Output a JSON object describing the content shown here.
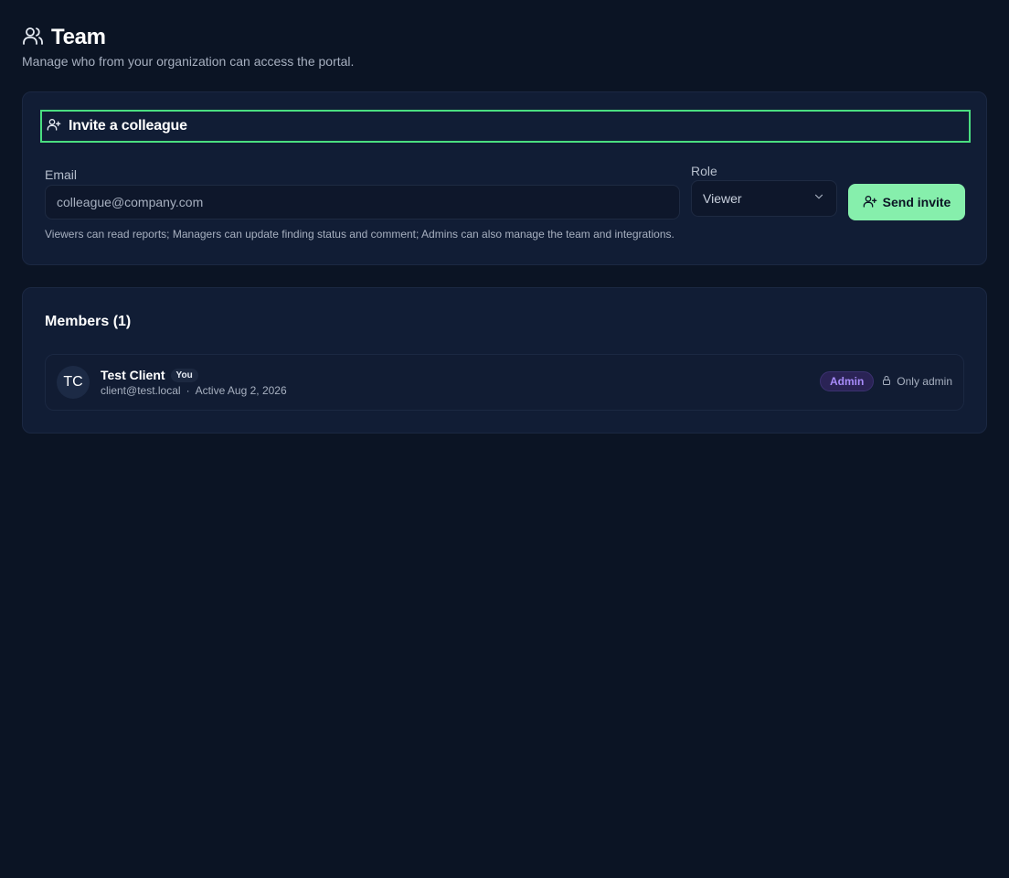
{
  "header": {
    "title": "Team",
    "subtitle": "Manage who from your organization can access the portal."
  },
  "invite": {
    "title": "Invite a colleague",
    "email_label": "Email",
    "email_placeholder": "colleague@company.com",
    "email_value": "",
    "role_label": "Role",
    "role_selected": "Viewer",
    "send_label": "Send invite",
    "hint": "Viewers can read reports; Managers can update finding status and comment; Admins can also manage the team and integrations."
  },
  "members": {
    "title": "Members (1)",
    "items": [
      {
        "initials": "TC",
        "name": "Test Client",
        "you_badge": "You",
        "email": "client@test.local",
        "separator": "·",
        "status": "Active Aug 2, 2026",
        "role": "Admin",
        "note": "Only admin"
      }
    ]
  },
  "colors": {
    "background": "#0b1424",
    "card": "#111d35",
    "accent_green": "#86efac",
    "focus_outline": "#4ade80",
    "admin_badge": "#a78bfa"
  },
  "icons": {
    "team": "users-icon",
    "invite": "user-plus-icon",
    "select": "chevron-down-icon",
    "lock": "lock-icon"
  }
}
